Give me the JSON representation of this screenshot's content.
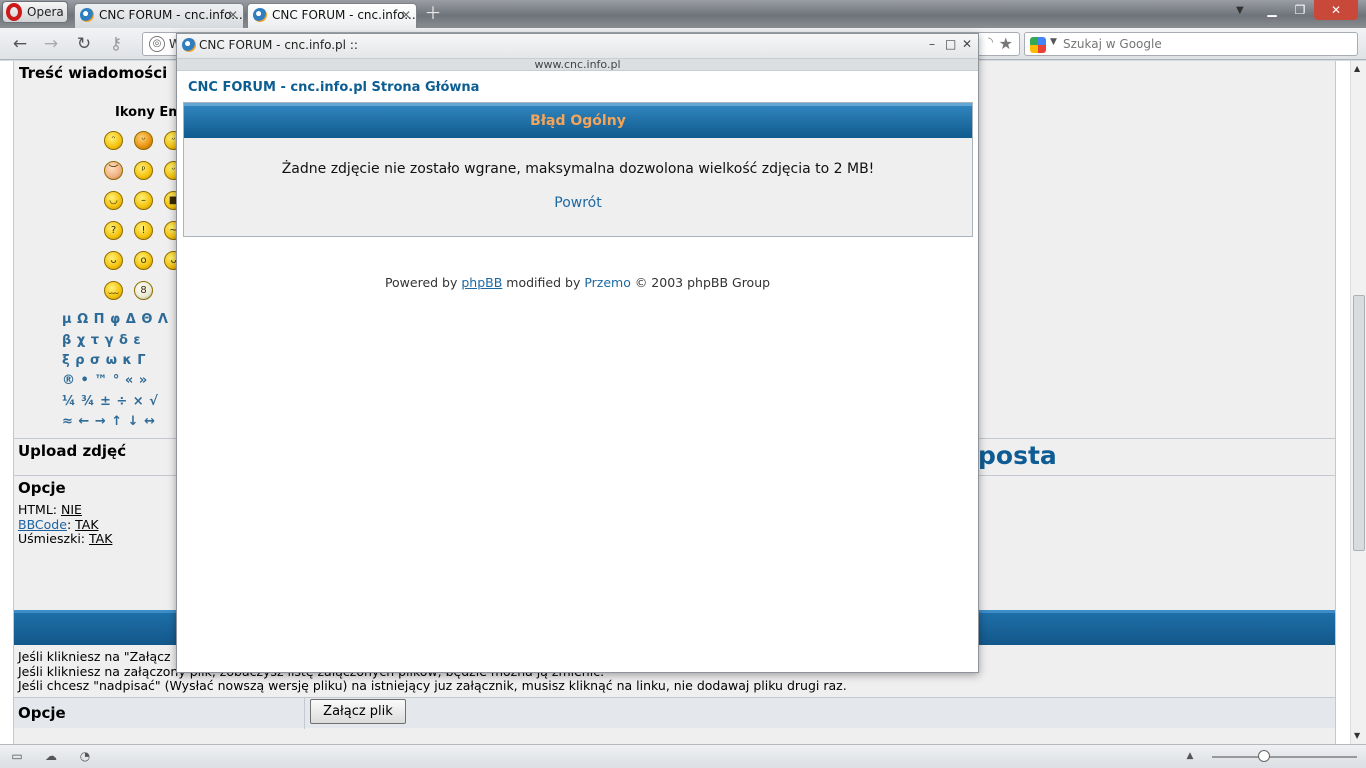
{
  "browser": {
    "menu_label": "Opera",
    "tabs": [
      {
        "title": "CNC FORUM - cnc.info..."
      },
      {
        "title": "CNC FORUM - cnc.info..."
      }
    ],
    "address_prefix": "W",
    "search_placeholder": "Szukaj w Google"
  },
  "page": {
    "message_label": "Treść wiadomości",
    "emoticons_label": "Ikony Em",
    "symbols": [
      "μ Ω Π φ Δ Θ Λ",
      "β χ τ γ δ ε",
      "ξ ρ σ ω κ Γ",
      "® • ™ ° « »",
      "¼ ¾ ± ÷ × √",
      "≈ ← → ↑ ↓ ↔"
    ],
    "upload_label": "Upload zdjęć",
    "posta_text": "posta",
    "options": {
      "title": "Opcje",
      "html_label": "HTML: ",
      "html_value": "NIE",
      "bbcode_label": "BBCode",
      "bbcode_sep": ": ",
      "bbcode_value": "TAK",
      "smileys_label": "Uśmieszki: ",
      "smileys_value": "TAK"
    },
    "notes": [
      "Jeśli klikniesz na \"Załącz",
      "Jeśli klikniesz na załączony plik, zobaczysz listę załączonych plików, będzie można ją zmienić.",
      "Jeśli chcesz \"nadpisać\" (Wysłać nowszą wersję pliku) na istniejący juz załącznik, musisz kliknąć na linku, nie dodawaj pliku drugi raz."
    ],
    "bottom_options_label": "Opcje",
    "attach_button": "Załącz plik"
  },
  "popup": {
    "window_title": "CNC FORUM - cnc.info.pl ::",
    "url": "www.cnc.info.pl",
    "site_link": "CNC FORUM - cnc.info.pl Strona Główna",
    "error_title": "Błąd Ogólny",
    "error_message": "Żadne zdjęcie nie zostało wgrane, maksymalna dozwolona wielkość zdjęcia to 2 MB!",
    "back_link": "Powrót",
    "footer": {
      "prefix": "Powered by ",
      "phpbb": "phpBB",
      "middle": " modified by ",
      "przemo": "Przemo",
      "suffix": " © 2003 phpBB Group"
    }
  },
  "colors": {
    "header_blue": "#13578a",
    "error_title": "#f5a55a",
    "link": "#1c69a3"
  }
}
